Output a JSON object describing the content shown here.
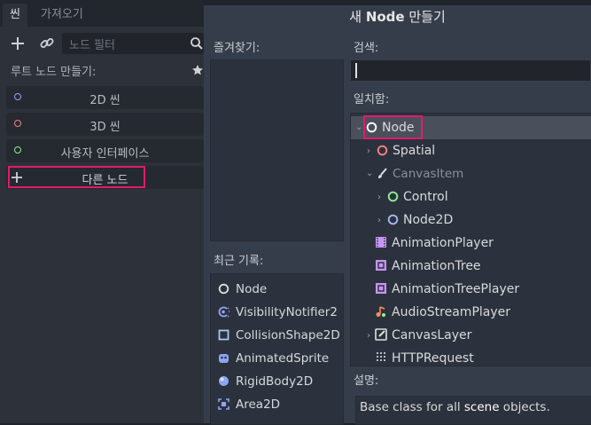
{
  "dock": {
    "tabs": [
      "씬",
      "가져오기"
    ],
    "filter_placeholder": "노드 필터",
    "root_title": "루트 노드 만들기:",
    "root_buttons": [
      {
        "label": "2D 씬",
        "color": "#8da5f3"
      },
      {
        "label": "3D 씬",
        "color": "#fc7f7f"
      },
      {
        "label": "사용자 인터페이스",
        "color": "#8eef97"
      }
    ],
    "other_node_label": "다른 노드"
  },
  "dialog": {
    "title_prefix": "새 ",
    "title_bold": "Node",
    "title_suffix": " 만들기",
    "favorites_label": "즐겨찾기:",
    "recent_label": "최근 기록:",
    "recent_items": [
      {
        "label": "Node",
        "icon": "node-icon"
      },
      {
        "label": "VisibilityNotifier2",
        "icon": "visibility-notifier-icon"
      },
      {
        "label": "CollisionShape2D",
        "icon": "collision-shape-icon"
      },
      {
        "label": "AnimatedSprite",
        "icon": "animated-sprite-icon"
      },
      {
        "label": "RigidBody2D",
        "icon": "rigid-body-icon"
      },
      {
        "label": "Area2D",
        "icon": "area2d-icon"
      }
    ],
    "search_label": "검색:",
    "search_value": "",
    "matches_label": "일치함:",
    "tree": [
      {
        "label": "Node",
        "icon": "node-icon"
      },
      {
        "label": "Spatial",
        "icon": "spatial-icon"
      },
      {
        "label": "CanvasItem",
        "icon": "canvas-item-icon"
      },
      {
        "label": "Control",
        "icon": "control-icon"
      },
      {
        "label": "Node2D",
        "icon": "node2d-icon"
      },
      {
        "label": "AnimationPlayer",
        "icon": "animation-player-icon"
      },
      {
        "label": "AnimationTree",
        "icon": "animation-tree-icon"
      },
      {
        "label": "AnimationTreePlayer",
        "icon": "animation-tree-player-icon"
      },
      {
        "label": "AudioStreamPlayer",
        "icon": "audio-stream-player-icon"
      },
      {
        "label": "CanvasLayer",
        "icon": "canvas-layer-icon"
      },
      {
        "label": "HTTPRequest",
        "icon": "http-request-icon"
      }
    ],
    "description_label": "설명:",
    "description_prefix": "Base class for all ",
    "description_bold": "scene",
    "description_suffix": " objects."
  }
}
